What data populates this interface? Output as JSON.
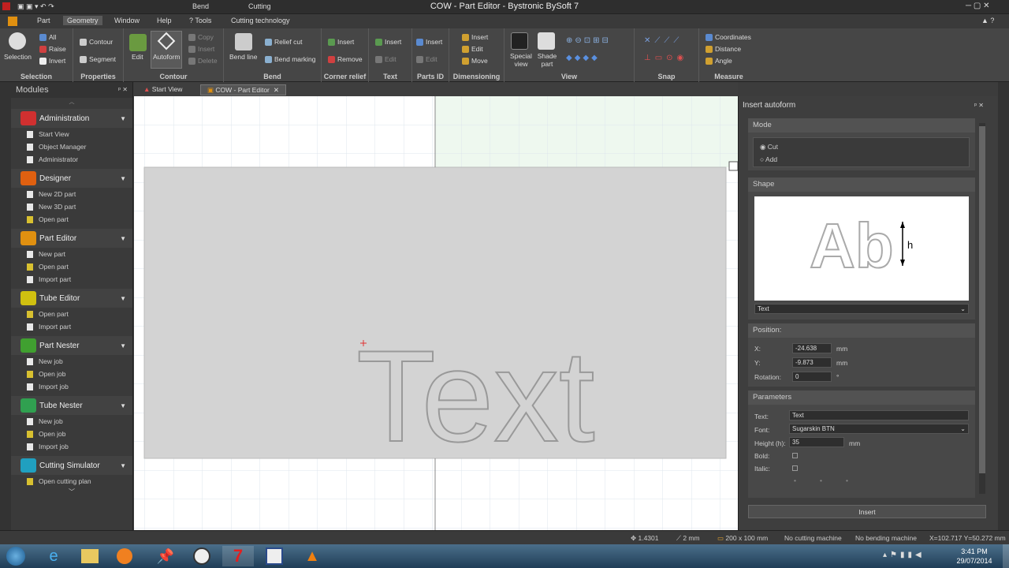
{
  "window": {
    "title": "COW - Part Editor - Bystronic BySoft 7",
    "context_tabs": [
      "Bend",
      "Cutting"
    ]
  },
  "menu": [
    "Part",
    "Geometry",
    "Window",
    "Help",
    "Tools",
    "Cutting technology"
  ],
  "ribbon": {
    "selection": {
      "label": "Selection",
      "button": "Selection",
      "items": [
        "All",
        "Raise",
        "Invert"
      ]
    },
    "properties": {
      "label": "Properties",
      "items": [
        "Contour",
        "Segment"
      ]
    },
    "contour": {
      "label": "Contour",
      "edit": "Edit",
      "autoform": "Autoform",
      "items": [
        "Copy",
        "Insert",
        "Delete"
      ]
    },
    "bend": {
      "label": "Bend",
      "bend_line": "Bend line",
      "items": [
        "Relief cut",
        "Bend marking"
      ]
    },
    "corner": {
      "label": "Corner relief",
      "items": [
        "Insert",
        "Remove"
      ]
    },
    "text": {
      "label": "Text",
      "items": [
        "Insert",
        "Edit"
      ]
    },
    "partsid": {
      "label": "Parts ID",
      "items": [
        "Insert",
        "Edit"
      ]
    },
    "dim": {
      "label": "Dimensioning",
      "items": [
        "Insert",
        "Edit",
        "Move"
      ]
    },
    "view": {
      "label": "View",
      "special": "Special view",
      "shade": "Shade part"
    },
    "snap": {
      "label": "Snap"
    },
    "measure": {
      "label": "Measure",
      "items": [
        "Coordinates",
        "Distance",
        "Angle"
      ]
    }
  },
  "modules": {
    "title": "Modules",
    "groups": [
      {
        "name": "Administration",
        "color": "#d03030",
        "items": [
          "Start View",
          "Object Manager",
          "Administrator"
        ]
      },
      {
        "name": "Designer",
        "color": "#e06010",
        "items": [
          "New 2D part",
          "New 3D part",
          "Open part"
        ]
      },
      {
        "name": "Part Editor",
        "color": "#e09010",
        "items": [
          "New part",
          "Open part",
          "Import part"
        ]
      },
      {
        "name": "Tube Editor",
        "color": "#d0c010",
        "items": [
          "Open part",
          "Import part"
        ]
      },
      {
        "name": "Part Nester",
        "color": "#40a030",
        "items": [
          "New job",
          "Open job",
          "Import job"
        ]
      },
      {
        "name": "Tube Nester",
        "color": "#30a050",
        "items": [
          "New job",
          "Open job",
          "Import job"
        ]
      },
      {
        "name": "Cutting Simulator",
        "color": "#20a0c0",
        "items": [
          "Open cutting plan"
        ]
      }
    ]
  },
  "tabs": [
    "Start View",
    "COW - Part Editor"
  ],
  "canvas": {
    "text": "Text"
  },
  "panel": {
    "title": "Insert autoform",
    "mode": {
      "label": "Mode",
      "options": [
        "Cut",
        "Add"
      ],
      "selected": "Cut"
    },
    "shape": {
      "label": "Shape",
      "preview_text": "Ab",
      "h_label": "h",
      "selected": "Text"
    },
    "position": {
      "label": "Position:",
      "x_label": "X:",
      "x": "-24.638",
      "y_label": "Y:",
      "y": "-9.873",
      "unit": "mm",
      "rot_label": "Rotation:",
      "rot": "0",
      "rot_unit": "°"
    },
    "params": {
      "label": "Parameters",
      "text_label": "Text:",
      "text": "Text",
      "font_label": "Font:",
      "font": "Sugarskin BTN",
      "height_label": "Height (h):",
      "height": "35",
      "unit": "mm",
      "bold": "Bold:",
      "italic": "Italic:"
    },
    "insert": "Insert"
  },
  "status": {
    "material": "1.4301",
    "tool": "2 mm",
    "sheet": "200 x 100 mm",
    "cutting": "No cutting machine",
    "bending": "No bending machine",
    "coords": "X=102.717  Y=50.272 mm"
  },
  "clock": {
    "time": "3:41 PM",
    "date": "29/07/2014"
  }
}
